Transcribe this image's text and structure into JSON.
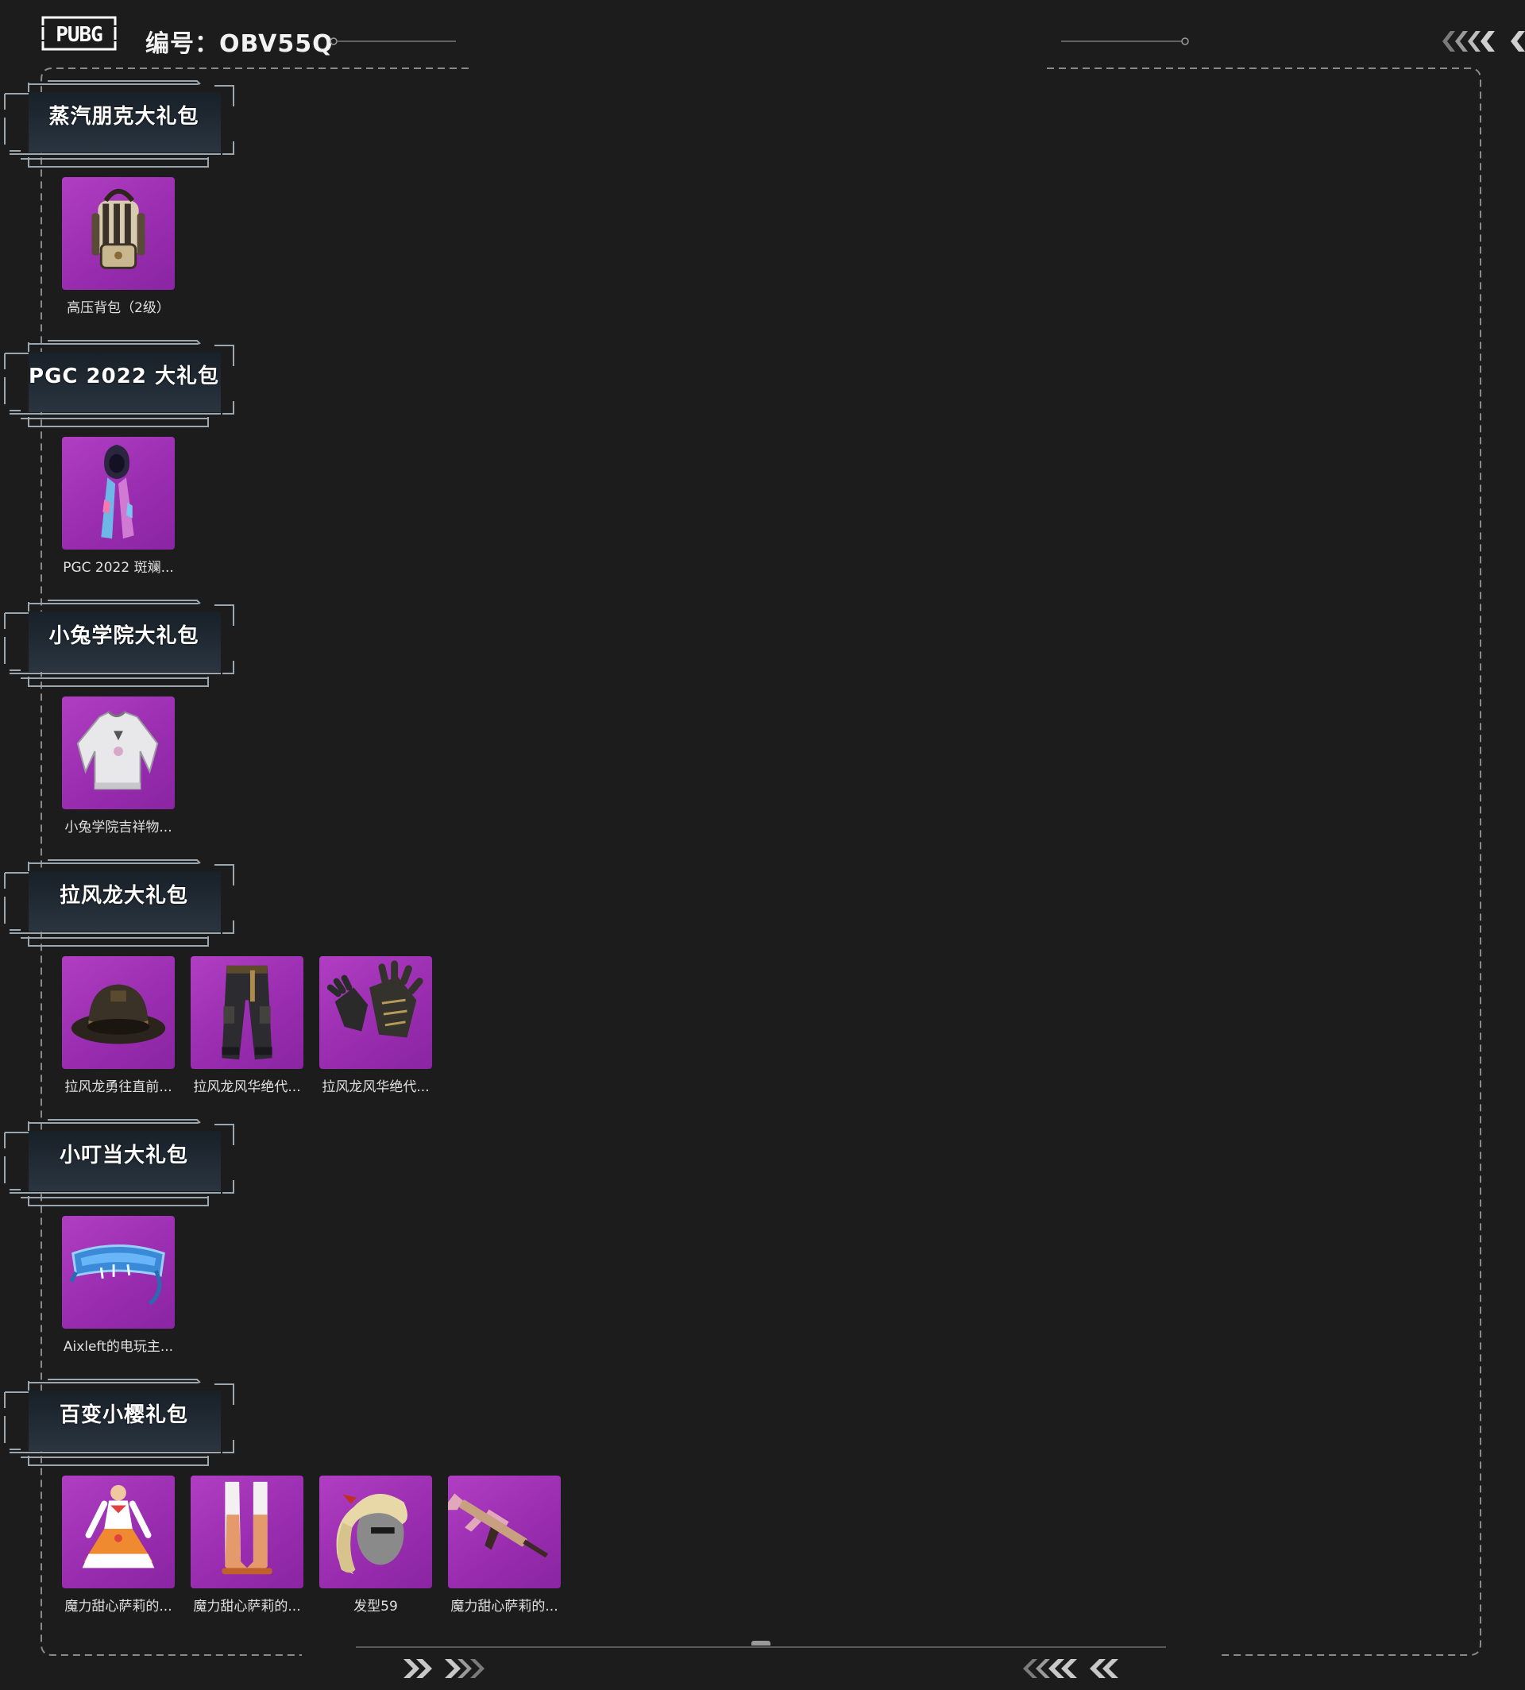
{
  "header": {
    "logo_text": "PUBG",
    "code_label": "编号：OBV55Q"
  },
  "colors": {
    "background": "#1c1c1c",
    "item_bg": "#a336b8",
    "frame_line": "#8a8a8a",
    "text": "#e0e0e0"
  },
  "sections": [
    {
      "title": "蒸汽朋克大礼包",
      "items": [
        {
          "name": "高压背包（2级）",
          "icon": "backpack-icon"
        }
      ]
    },
    {
      "title": "PGC 2022 大礼包",
      "items": [
        {
          "name": "PGC 2022 斑斓...",
          "icon": "mask-scarf-icon"
        }
      ]
    },
    {
      "title": "小兔学院大礼包",
      "items": [
        {
          "name": "小兔学院吉祥物...",
          "icon": "sweater-icon"
        }
      ]
    },
    {
      "title": "拉风龙大礼包",
      "items": [
        {
          "name": "拉风龙勇往直前...",
          "icon": "bucket-hat-icon"
        },
        {
          "name": "拉风龙风华绝代...",
          "icon": "pants-icon"
        },
        {
          "name": "拉风龙风华绝代...",
          "icon": "gloves-icon"
        }
      ]
    },
    {
      "title": "小叮当大礼包",
      "items": [
        {
          "name": "Aixleft的电玩主...",
          "icon": "visor-glasses-icon"
        }
      ]
    },
    {
      "title": "百变小樱礼包",
      "items": [
        {
          "name": "魔力甜心萨莉的...",
          "icon": "dress-icon"
        },
        {
          "name": "魔力甜心萨莉的...",
          "icon": "boots-icon"
        },
        {
          "name": "发型59",
          "icon": "hairstyle-icon"
        },
        {
          "name": "魔力甜心萨莉的...",
          "icon": "rifle-icon"
        }
      ]
    }
  ]
}
